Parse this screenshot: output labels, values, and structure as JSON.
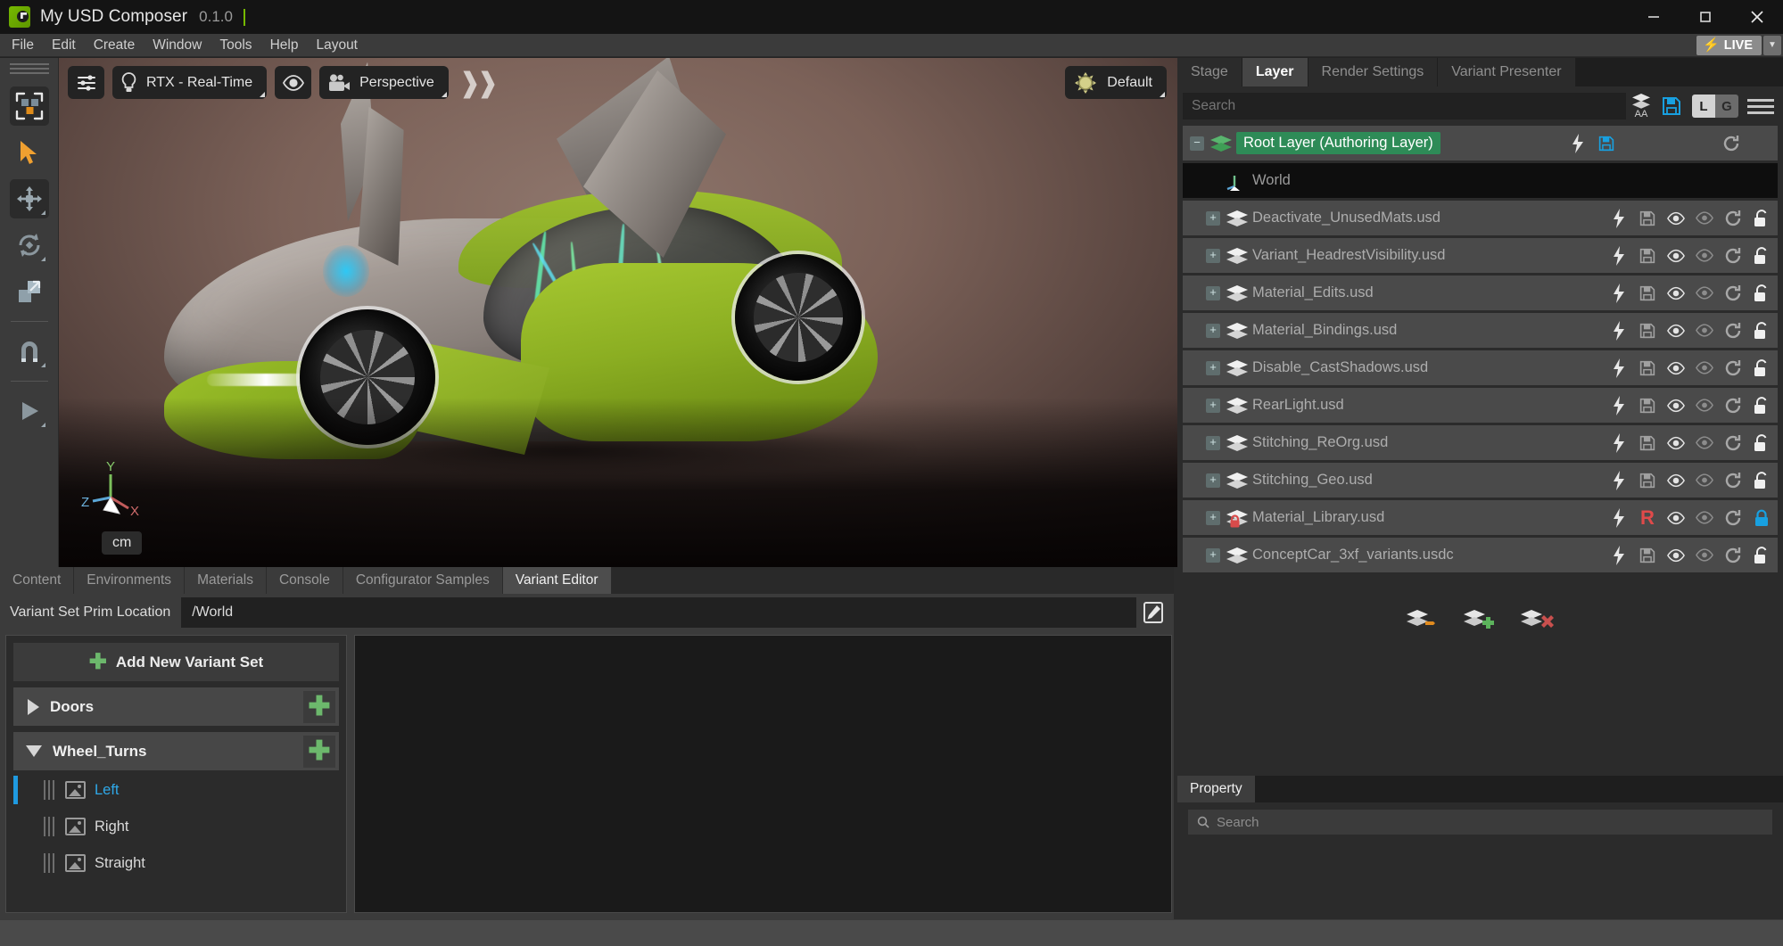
{
  "titlebar": {
    "app_name": "My USD Composer",
    "version": "0.1.0",
    "icon": "usd-composer-logo",
    "minimize": "minimize-icon",
    "maximize": "maximize-icon",
    "close": "close-icon"
  },
  "menubar": {
    "items": [
      {
        "label": "File"
      },
      {
        "label": "Edit"
      },
      {
        "label": "Create"
      },
      {
        "label": "Window"
      },
      {
        "label": "Tools"
      },
      {
        "label": "Help"
      },
      {
        "label": "Layout"
      }
    ],
    "live_label": "LIVE",
    "live_bolt": "⚡",
    "live_caret": "⌄"
  },
  "left_toolbar": {
    "items": [
      {
        "name": "select-mode-tool",
        "active": true
      },
      {
        "name": "select-arrow-tool",
        "active": false
      },
      {
        "name": "move-tool",
        "active": true
      },
      {
        "name": "rotate-tool",
        "active": false
      },
      {
        "name": "scale-tool",
        "active": false
      },
      {
        "name": "snap-tool",
        "active": false
      },
      {
        "name": "play-tool",
        "active": false
      }
    ]
  },
  "viewport": {
    "settings_icon": "sliders-icon",
    "renderer_label": "RTX - Real-Time",
    "renderer_icon": "lightbulb-icon",
    "eye_icon": "eye-icon",
    "camera_label": "Perspective",
    "camera_icon": "camera-icon",
    "expand_chevron": "❯",
    "lighting_label": "Default",
    "lighting_icon": "sun-icon",
    "units_label": "cm",
    "axis_x": "X",
    "axis_y": "Y",
    "axis_z": "Z",
    "axis_colors": {
      "x": "#c15b5b",
      "y": "#7cbf5b",
      "z": "#5ba6d6"
    },
    "scene": "concept-car-green-silver"
  },
  "bottom_dock": {
    "tabs": [
      {
        "label": "Content",
        "active": false
      },
      {
        "label": "Environments",
        "active": false
      },
      {
        "label": "Materials",
        "active": false
      },
      {
        "label": "Console",
        "active": false
      },
      {
        "label": "Configurator Samples",
        "active": false
      },
      {
        "label": "Variant Editor",
        "active": true
      }
    ],
    "prim_location_label": "Variant Set Prim Location",
    "prim_location_value": "/World",
    "prim_location_placeholder": "/World",
    "edit_icon": "edit-pencil-icon",
    "add_variant_set_label": "Add New Variant Set",
    "variant_sets": [
      {
        "name": "Doors",
        "expanded": false,
        "variants": []
      },
      {
        "name": "Wheel_Turns",
        "expanded": true,
        "variants": [
          {
            "name": "Left",
            "selected": true
          },
          {
            "name": "Right",
            "selected": false
          },
          {
            "name": "Straight",
            "selected": false
          }
        ]
      }
    ]
  },
  "right_dock": {
    "tabs": [
      {
        "label": "Stage",
        "active": false
      },
      {
        "label": "Layer",
        "active": true
      },
      {
        "label": "Render Settings",
        "active": false
      },
      {
        "label": "Variant Presenter",
        "active": false
      }
    ],
    "search_placeholder": "Search",
    "search_value": "",
    "toolbar": {
      "layers_aa_icon": "layers-icon",
      "layers_aa_label": "AA",
      "save_icon": "save-icon",
      "local_label": "L",
      "global_label": "G",
      "local_active": true,
      "menu_icon": "hamburger-menu-icon"
    },
    "layers": [
      {
        "name": "Root Layer (Authoring Layer)",
        "kind": "root",
        "expander": "−",
        "indent": 0,
        "icons": [
          "lightning-icon",
          "save-icon",
          "reload-icon"
        ],
        "save_color": "#18a0e0",
        "locked": false
      },
      {
        "name": "World",
        "kind": "prim",
        "expander": "",
        "indent": 1,
        "icons": [],
        "locked": false
      },
      {
        "name": "Deactivate_UnusedMats.usd",
        "kind": "sublayer",
        "expander": "+",
        "indent": 1,
        "icons": [
          "lightning-icon",
          "save-icon",
          "eye-icon",
          "eye-outline-icon",
          "reload-icon",
          "unlock-icon"
        ],
        "locked": false
      },
      {
        "name": "Variant_HeadrestVisibility.usd",
        "kind": "sublayer",
        "expander": "+",
        "indent": 1,
        "icons": [
          "lightning-icon",
          "save-icon",
          "eye-icon",
          "eye-outline-icon",
          "reload-icon",
          "unlock-icon"
        ],
        "locked": false
      },
      {
        "name": "Material_Edits.usd",
        "kind": "sublayer",
        "expander": "+",
        "indent": 1,
        "icons": [
          "lightning-icon",
          "save-icon",
          "eye-icon",
          "eye-outline-icon",
          "reload-icon",
          "unlock-icon"
        ],
        "locked": false
      },
      {
        "name": "Material_Bindings.usd",
        "kind": "sublayer",
        "expander": "+",
        "indent": 1,
        "icons": [
          "lightning-icon",
          "save-icon",
          "eye-icon",
          "eye-outline-icon",
          "reload-icon",
          "unlock-icon"
        ],
        "locked": false
      },
      {
        "name": "Disable_CastShadows.usd",
        "kind": "sublayer",
        "expander": "+",
        "indent": 1,
        "icons": [
          "lightning-icon",
          "save-icon",
          "eye-icon",
          "eye-outline-icon",
          "reload-icon",
          "unlock-icon"
        ],
        "locked": false
      },
      {
        "name": "RearLight.usd",
        "kind": "sublayer",
        "expander": "+",
        "indent": 1,
        "icons": [
          "lightning-icon",
          "save-icon",
          "eye-icon",
          "eye-outline-icon",
          "reload-icon",
          "unlock-icon"
        ],
        "locked": false
      },
      {
        "name": "Stitching_ReOrg.usd",
        "kind": "sublayer",
        "expander": "+",
        "indent": 1,
        "icons": [
          "lightning-icon",
          "save-icon",
          "eye-icon",
          "eye-outline-icon",
          "reload-icon",
          "unlock-icon"
        ],
        "locked": false
      },
      {
        "name": "Stitching_Geo.usd",
        "kind": "sublayer",
        "expander": "+",
        "indent": 1,
        "icons": [
          "lightning-icon",
          "save-icon",
          "eye-icon",
          "eye-outline-icon",
          "reload-icon",
          "unlock-icon"
        ],
        "locked": false
      },
      {
        "name": "Material_Library.usd",
        "kind": "sublayer",
        "expander": "+",
        "indent": 1,
        "icons": [
          "lightning-icon",
          "readonly-R-icon",
          "eye-icon",
          "eye-outline-icon",
          "reload-icon",
          "lock-icon"
        ],
        "readonly_badge": "R",
        "readonly_color": "#e04a4a",
        "lock_color": "#18a0e0",
        "locked": true
      },
      {
        "name": "ConceptCar_3xf_variants.usdc",
        "kind": "sublayer",
        "expander": "+",
        "indent": 1,
        "icons": [
          "lightning-icon",
          "save-icon",
          "eye-icon",
          "eye-outline-icon",
          "reload-icon",
          "unlock-icon"
        ],
        "locked": false
      }
    ],
    "footer_buttons": [
      {
        "name": "move-layer-icon"
      },
      {
        "name": "add-layer-icon"
      },
      {
        "name": "remove-layer-icon"
      }
    ],
    "property_panel": {
      "tab_label": "Property",
      "search_placeholder": "Search",
      "search_icon": "search-icon"
    }
  },
  "colors": {
    "accent_green": "#76b900",
    "root_layer_green": "#2e8b57",
    "selection_blue": "#1f9ae0",
    "readonly_red": "#e04a4a",
    "save_blue": "#18a0e0"
  }
}
